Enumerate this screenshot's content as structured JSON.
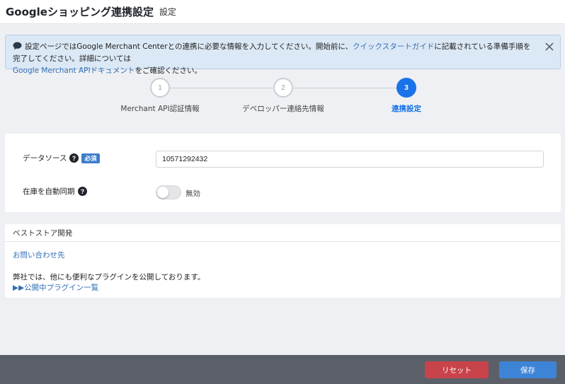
{
  "header": {
    "title": "Googleショッピング連携設定",
    "subtitle": "設定"
  },
  "notice": {
    "text1": "設定ページではGoogle Merchant Centerとの連携に必要な情報を入力してください。開始前に、",
    "link1": "クイックスタートガイド",
    "text2": "に記載されている準備手順を完了してください。詳細については",
    "link2": "Google Merchant APIドキュメント",
    "text3": "をご確認ください。",
    "icon": "chat-icon",
    "close_icon": "close-icon"
  },
  "stepper": {
    "steps": [
      {
        "number": "1",
        "label": "Merchant API認証情報"
      },
      {
        "number": "2",
        "label": "デベロッパー連絡先情報"
      },
      {
        "number": "3",
        "label": "連携設定"
      }
    ],
    "active": 3
  },
  "settings": {
    "datasource_label": "データソース",
    "required_badge": "必須",
    "datasource_value": "10571292432",
    "inventory_label": "在庫を自動同期",
    "toggle_state": "無効"
  },
  "bestore": {
    "title": "ベストストア開発",
    "contact_link": "お問い合わせ先",
    "desc": "弊社では、他にも便利なプラグインを公開しております。",
    "plugin_link": "▶▶公開中プラグイン一覧"
  },
  "footer": {
    "reset_label": "リセット",
    "save_label": "保存"
  },
  "colors": {
    "accent": "#1a73e8",
    "reset": "#c9444a",
    "save": "#3d84d6",
    "footer": "#5b6068"
  }
}
